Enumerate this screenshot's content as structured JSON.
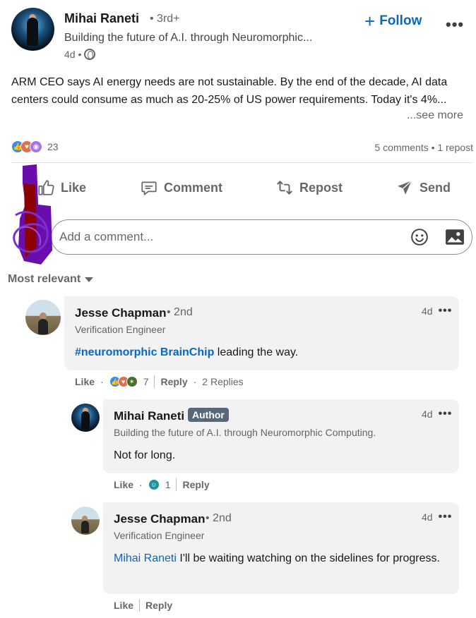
{
  "post": {
    "author_name": "Mihai Raneti",
    "degree": "• 3rd+",
    "headline": "Building the future of A.I. through Neuromorphic...",
    "time": "4d •",
    "follow_label": "Follow",
    "more_label": "•••",
    "text": "ARM CEO says AI energy needs are not sustainable. By the end of the decade, AI data centers could consume as much as 20-25% of US power requirements. Today it's 4%...",
    "see_more": "...see more",
    "reaction_count": "23",
    "comments_reposts": "5 comments • 1 repost"
  },
  "actions": {
    "like": "Like",
    "comment": "Comment",
    "repost": "Repost",
    "send": "Send"
  },
  "comment_input": {
    "placeholder": "Add a comment..."
  },
  "sort": {
    "label": "Most relevant"
  },
  "comments": [
    {
      "name": "Jesse Chapman",
      "degree": "• 2nd",
      "headline": "Verification Engineer",
      "time": "4d",
      "body_link": "#neuromorphic BrainChip",
      "body_rest": " leading the way.",
      "like": "Like",
      "reaction_count": "7",
      "reply": "Reply",
      "replies": "2 Replies"
    },
    {
      "name": "Mihai Raneti",
      "badge": "Author",
      "headline": "Building the future of A.I. through Neuromorphic Computing.",
      "time": "4d",
      "body": "Not for long.",
      "like": "Like",
      "reaction_count": "1",
      "reply": "Reply"
    },
    {
      "name": "Jesse Chapman",
      "degree": "• 2nd",
      "headline": "Verification Engineer",
      "time": "4d",
      "mention": "Mihai Raneti",
      "body_rest": " I'll be waiting watching on the sidelines for progress.",
      "like": "Like",
      "reply": "Reply"
    }
  ],
  "colors": {
    "accent": "#0a66c2",
    "bubble": "#f2f2f2",
    "author_badge": "#56687a",
    "scribble_purple": "#6a0dad",
    "scribble_red": "#8b0000"
  }
}
